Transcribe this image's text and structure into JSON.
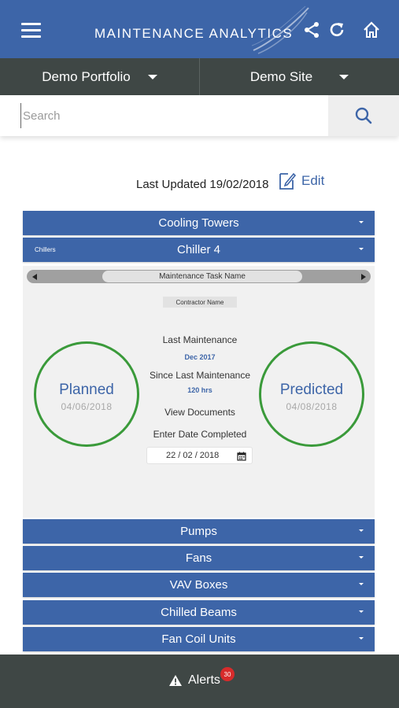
{
  "header": {
    "title": "MAINTENANCE ANALYTICS",
    "icons": [
      "menu-icon",
      "share-icon",
      "refresh-icon",
      "home-icon"
    ]
  },
  "selectors": {
    "portfolio": "Demo Portfolio",
    "site": "Demo Site"
  },
  "search": {
    "placeholder": "Search",
    "value": ""
  },
  "status": {
    "last_updated": "Last Updated 19/02/2018",
    "edit_label": "Edit"
  },
  "categories_top": [
    {
      "label": "Cooling Towers"
    }
  ],
  "selected_category": {
    "parent": "Chillers",
    "label": "Chiller 4"
  },
  "detail": {
    "task_name": "Maintenance Task Name",
    "contractor": "Contractor Name",
    "planned_label": "Planned",
    "planned_date": "04/06/2018",
    "predicted_label": "Predicted",
    "predicted_date": "04/08/2018",
    "last_maintenance_label": "Last Maintenance",
    "last_maintenance_value": "Dec 2017",
    "since_label": "Since Last Maintenance",
    "since_value": "120 hrs",
    "view_documents": "View Documents",
    "enter_date_label": "Enter Date Completed",
    "date_value": "22 / 02 / 2018"
  },
  "categories_bottom": [
    {
      "label": "Pumps"
    },
    {
      "label": "Fans"
    },
    {
      "label": "VAV Boxes"
    },
    {
      "label": "Chilled Beams"
    },
    {
      "label": "Fan Coil Units"
    }
  ],
  "footer": {
    "alerts_label": "Alerts",
    "alerts_count": "30"
  },
  "colors": {
    "primary": "#3d65a8",
    "dark": "#3f4745",
    "status_green": "#3a9a3a",
    "badge_red": "#d72b2b"
  }
}
